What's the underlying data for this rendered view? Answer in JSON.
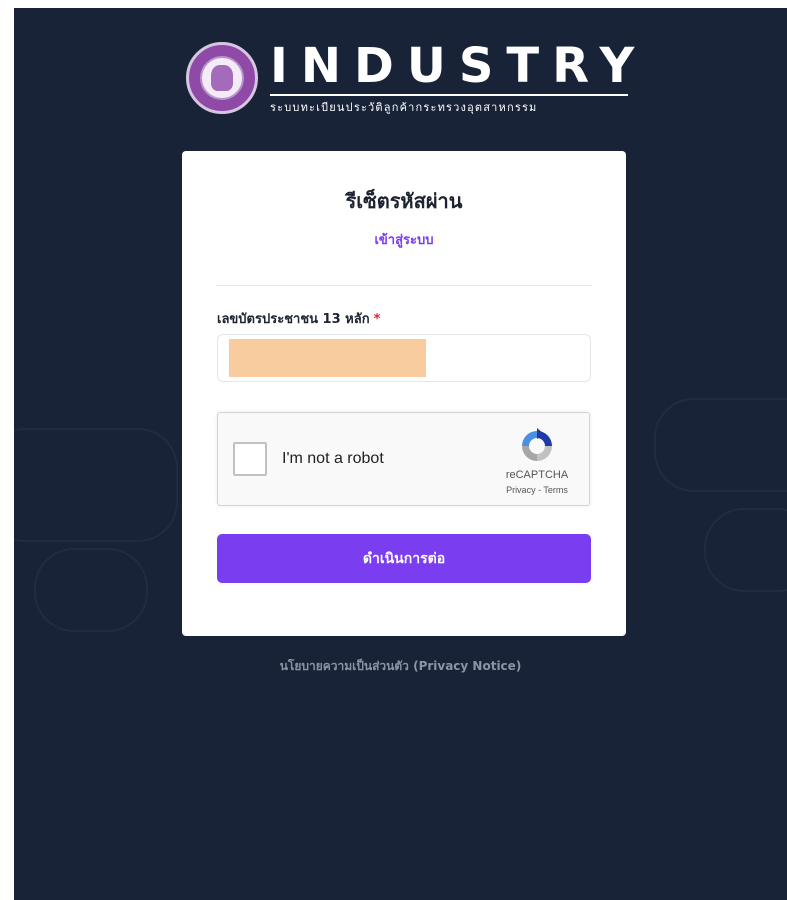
{
  "brand": {
    "title": "INDUSTRY",
    "subtitle": "ระบบทะเบียนประวัติลูกค้ากระทรวงอุตสาหกรรม",
    "seal_icon": "ministry-seal-icon"
  },
  "card": {
    "title": "รีเซ็ตรหัสผ่าน",
    "login_link": "เข้าสู่ระบบ",
    "field_label": "เลขบัตรประชาชน 13 หลัก",
    "required_mark": "*",
    "id_input_value": "",
    "submit_label": "ดำเนินการต่อ"
  },
  "recaptcha": {
    "label": "I'm not a robot",
    "brand": "reCAPTCHA",
    "privacy": "Privacy",
    "separator": " - ",
    "terms": "Terms",
    "logo_icon": "recaptcha-logo-icon"
  },
  "footer": {
    "privacy_notice": "นโยบายความเป็นส่วนตัว (Privacy Notice)"
  },
  "colors": {
    "background": "#182338",
    "accent": "#7a3df0",
    "redaction": "#f8cc9f"
  }
}
